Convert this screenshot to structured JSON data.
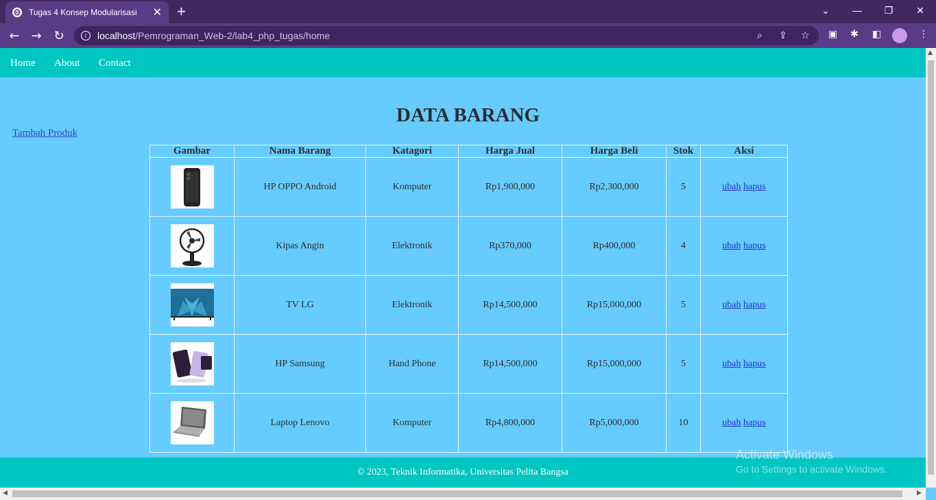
{
  "browser": {
    "tab_title": "Tugas 4 Konsep Modularisasi",
    "url_host": "localhost",
    "url_path": "/Pemrograman_Web-2/lab4_php_tugas/home"
  },
  "nav": {
    "home": "Home",
    "about": "About",
    "contact": "Contact"
  },
  "page": {
    "title": "DATA BARANG",
    "add_link": "Tambah Produk"
  },
  "table": {
    "headers": [
      "Gambar",
      "Nama Barang",
      "Katagori",
      "Harga Jual",
      "Harga Beli",
      "Stok",
      "Aksi"
    ],
    "rows": [
      {
        "image": "phone-image",
        "name": "HP OPPO Android",
        "category": "Komputer",
        "sell": "Rp1,900,000",
        "buy": "Rp2,300,000",
        "stock": "5",
        "edit": "ubah",
        "delete": "hapus"
      },
      {
        "image": "fan-image",
        "name": "Kipas Angin",
        "category": "Elektronik",
        "sell": "Rp370,000",
        "buy": "Rp400,000",
        "stock": "4",
        "edit": "ubah",
        "delete": "hapus"
      },
      {
        "image": "tv-image",
        "name": "TV LG",
        "category": "Elektronik",
        "sell": "Rp14,500,000",
        "buy": "Rp15,000,000",
        "stock": "5",
        "edit": "ubah",
        "delete": "hapus"
      },
      {
        "image": "foldable-phone-image",
        "name": "HP Samsung",
        "category": "Hand Phone",
        "sell": "Rp14,500,000",
        "buy": "Rp15,000,000",
        "stock": "5",
        "edit": "ubah",
        "delete": "hapus"
      },
      {
        "image": "laptop-image",
        "name": "Laptop Lenovo",
        "category": "Komputer",
        "sell": "Rp4,800,000",
        "buy": "Rp5,000,000",
        "stock": "10",
        "edit": "ubah",
        "delete": "hapus"
      }
    ]
  },
  "footer": {
    "text": "© 2023, Teknik Informatika, Universitas Pelita Bangsa"
  },
  "watermark": {
    "line1": "Activate Windows",
    "line2": "Go to Settings to activate Windows."
  },
  "colors": {
    "page_bg": "#66ccff",
    "nav_bg": "#00c6c2",
    "browser_frame": "#44275f"
  }
}
